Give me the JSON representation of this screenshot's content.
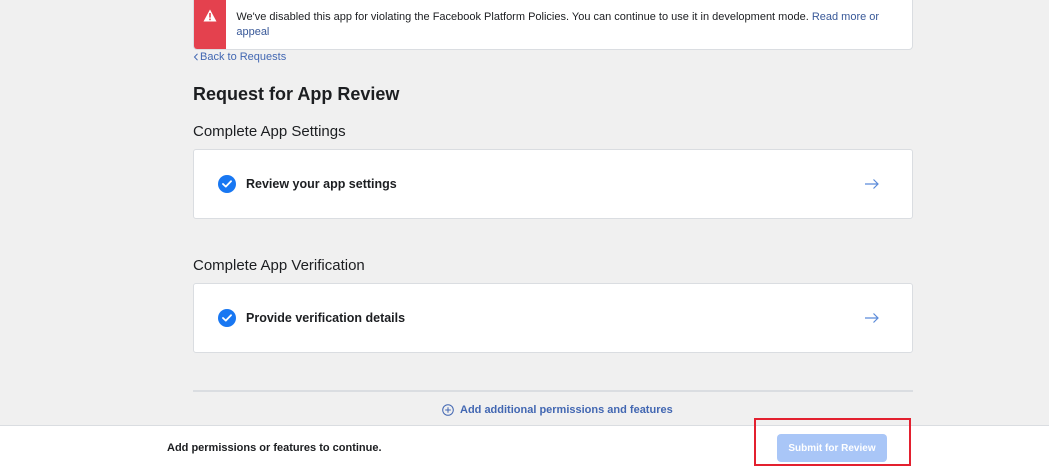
{
  "alert": {
    "message": "We've disabled this app for violating the Facebook Platform Policies. You can continue to use it in development mode.",
    "link_label": "Read more or appeal",
    "icon": "warning-icon",
    "accent_color": "#e4414e"
  },
  "nav": {
    "back_label": "Back to Requests"
  },
  "page": {
    "title": "Request for App Review"
  },
  "sections": [
    {
      "title": "Complete App Settings",
      "item_label": "Review your app settings",
      "status": "complete"
    },
    {
      "title": "Complete App Verification",
      "item_label": "Provide verification details",
      "status": "complete"
    }
  ],
  "actions": {
    "add_permissions_label": "Add additional permissions and features"
  },
  "footer": {
    "message": "Add permissions or features to continue.",
    "submit_label": "Submit for Review",
    "submit_enabled": false,
    "highlight_color": "#e3202f"
  },
  "colors": {
    "brand_blue": "#1877f2",
    "link_blue": "#4267b2",
    "disabled_button": "#a9c6f7"
  }
}
